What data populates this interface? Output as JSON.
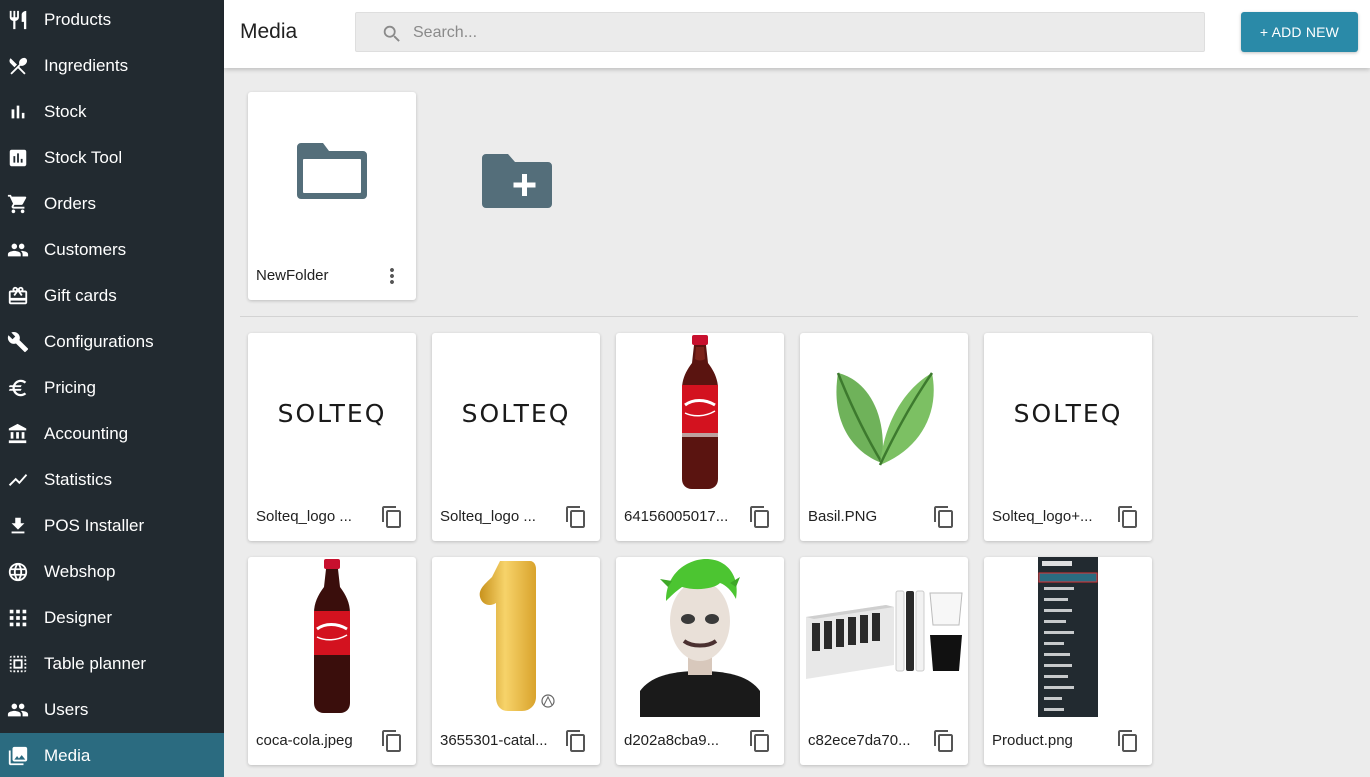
{
  "header": {
    "title": "Media",
    "search_placeholder": "Search...",
    "add_new_label": "+ ADD NEW"
  },
  "sidebar": {
    "items": [
      {
        "label": "Products",
        "icon": "cutlery-icon"
      },
      {
        "label": "Ingredients",
        "icon": "utensils-crossed-icon"
      },
      {
        "label": "Stock",
        "icon": "bar-chart-icon"
      },
      {
        "label": "Stock Tool",
        "icon": "poll-icon"
      },
      {
        "label": "Orders",
        "icon": "cart-icon"
      },
      {
        "label": "Customers",
        "icon": "people-icon"
      },
      {
        "label": "Gift cards",
        "icon": "gift-card-icon"
      },
      {
        "label": "Configurations",
        "icon": "wrench-icon"
      },
      {
        "label": "Pricing",
        "icon": "euro-icon"
      },
      {
        "label": "Accounting",
        "icon": "bank-icon"
      },
      {
        "label": "Statistics",
        "icon": "trending-icon"
      },
      {
        "label": "POS Installer",
        "icon": "download-icon"
      },
      {
        "label": "Webshop",
        "icon": "globe-icon"
      },
      {
        "label": "Designer",
        "icon": "grid-dots-icon"
      },
      {
        "label": "Table planner",
        "icon": "grid-select-icon"
      },
      {
        "label": "Users",
        "icon": "people-icon"
      },
      {
        "label": "Media",
        "icon": "image-icon",
        "active": true
      }
    ],
    "active_color": "#2b6b80",
    "background_color": "#222a30"
  },
  "folders": [
    {
      "name": "NewFolder",
      "icon": "folder-icon",
      "menu_icon": "more-vertical-icon"
    }
  ],
  "new_folder_icon": "create-folder-icon",
  "media": [
    {
      "name": "Solteq_logo ...",
      "logo_text": "SOLTEQ",
      "thumb": "solteq-logo"
    },
    {
      "name": "Solteq_logo ...",
      "logo_text": "SOLTEQ",
      "thumb": "solteq-logo"
    },
    {
      "name": "64156005017...",
      "thumb": "coca-cola-bottle"
    },
    {
      "name": "Basil.PNG",
      "thumb": "basil-leaves"
    },
    {
      "name": "Solteq_logo+...",
      "logo_text": "SOLTEQ",
      "thumb": "solteq-logo"
    },
    {
      "name": "coca-cola.jpeg",
      "thumb": "coca-cola-bottle"
    },
    {
      "name": "3655301-catal...",
      "thumb": "gold-balloon-number-one"
    },
    {
      "name": "d202a8cba9...",
      "thumb": "joker-costume-person"
    },
    {
      "name": "c82ece7da70...",
      "thumb": "cups-box"
    },
    {
      "name": "Product.png",
      "thumb": "cloudpos-screenshot"
    }
  ],
  "copy_icon": "copy-icon",
  "colors": {
    "accent": "#2a8aa8",
    "folder": "#546e7a"
  }
}
